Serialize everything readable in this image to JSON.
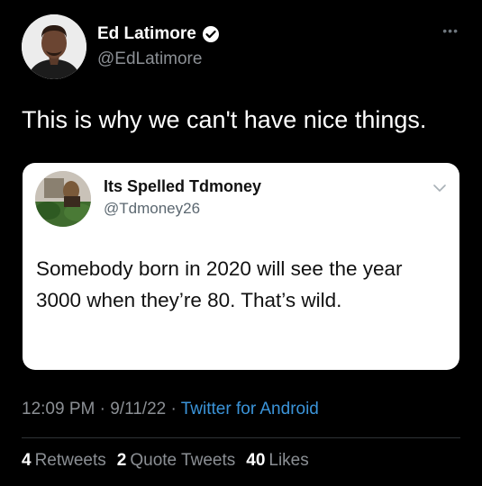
{
  "tweet": {
    "author": {
      "display_name": "Ed Latimore",
      "handle": "@EdLatimore",
      "verified_icon": "verified-badge-icon"
    },
    "more_icon": "more-options-icon",
    "text": "This is why we can't have nice things.",
    "quoted": {
      "display_name": "Its Spelled Tdmoney",
      "handle": "@Tdmoney26",
      "chevron_icon": "chevron-down-icon",
      "text": "Somebody born in 2020 will see the year 3000 when they’re 80. That’s wild."
    },
    "meta": {
      "time": "12:09 PM",
      "separator": "·",
      "date": "9/11/22",
      "source": "Twitter for Android"
    },
    "stats": {
      "retweets_count": "4",
      "retweets_label": "Retweets",
      "quotes_count": "2",
      "quotes_label": "Quote Tweets",
      "likes_count": "40",
      "likes_label": "Likes"
    }
  },
  "colors": {
    "background": "#000000",
    "primary_text": "#ffffff",
    "secondary_text": "#8b8f94",
    "link": "#3b94d9",
    "quote_card": "#ffffff"
  }
}
